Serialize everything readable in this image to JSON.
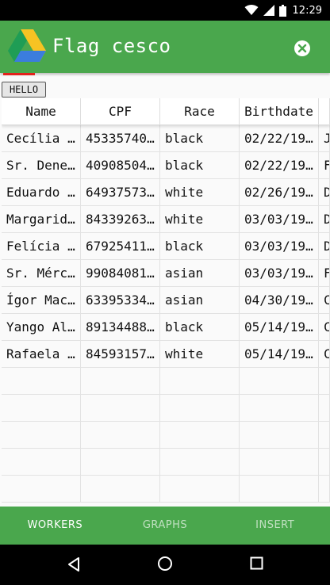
{
  "status_bar": {
    "time": "12:29",
    "icons": [
      "wifi-icon",
      "cell-signal-icon",
      "battery-icon"
    ]
  },
  "app_bar": {
    "title": "Flag cesco",
    "logo": "google-drive-logo",
    "close_icon": "close-icon"
  },
  "hello_button": "HELLO",
  "table": {
    "columns": [
      "Name",
      "CPF",
      "Race",
      "Birthdate",
      ""
    ],
    "rows": [
      [
        "Cecília …",
        "45335740…",
        "black",
        "02/22/19…",
        "J"
      ],
      [
        "Sr. Dene…",
        "40908504…",
        "black",
        "02/22/19…",
        "F"
      ],
      [
        "Eduardo …",
        "64937573…",
        "white",
        "02/26/19…",
        "D"
      ],
      [
        "Margarid…",
        "84339263…",
        "white",
        "03/03/19…",
        "D"
      ],
      [
        "Felícia …",
        "67925411…",
        "black",
        "03/03/19…",
        "D"
      ],
      [
        "Sr. Mérc…",
        "99084081…",
        "asian",
        "03/03/19…",
        "F"
      ],
      [
        "Ígor Mac…",
        "63395334…",
        "asian",
        "04/30/19…",
        "C"
      ],
      [
        "Yango Al…",
        "89134488…",
        "black",
        "05/14/19…",
        "C"
      ],
      [
        "Rafaela …",
        "84593157…",
        "white",
        "05/14/19…",
        "C"
      ]
    ],
    "empty_rows": 5
  },
  "bottom_nav": {
    "tabs": [
      "WORKERS",
      "GRAPHS",
      "INSERT"
    ],
    "active": "WORKERS"
  },
  "system_nav": [
    "back-icon",
    "home-icon",
    "recents-icon"
  ],
  "colors": {
    "app_bar": "#4aa74d",
    "indicator": "#e3221b",
    "status_bar": "#000000"
  }
}
